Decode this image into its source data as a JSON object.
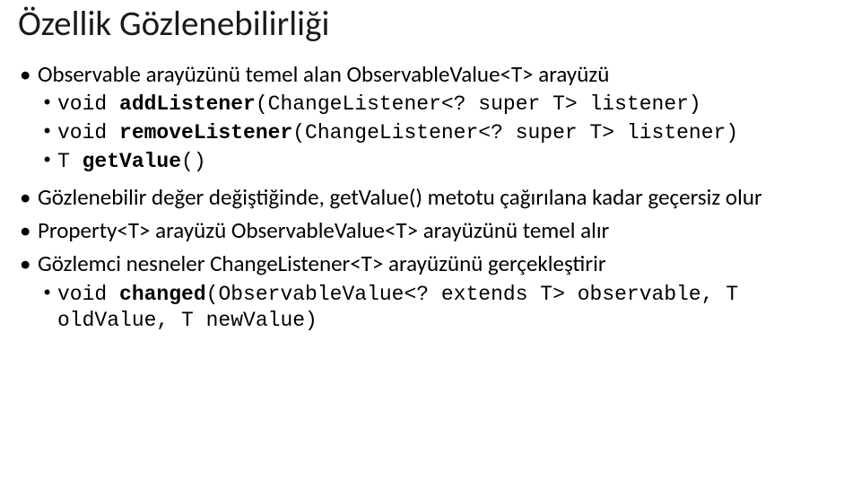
{
  "title": "Özellik Gözlenebilirliği",
  "b1": {
    "p1": "Observable arayüzünü temel alan ObservableValue<T> arayüzü",
    "sub": {
      "s1_a": "void ",
      "s1_b": "addListener",
      "s1_c": "(ChangeListener<? super T> listener)",
      "s2_a": "void ",
      "s2_b": "removeListener",
      "s2_c": "(ChangeListener<? super T> listener)",
      "s3_a": "T ",
      "s3_b": "getValue",
      "s3_c": "()"
    }
  },
  "b2": "Gözlenebilir değer değiştiğinde, getValue()  metotu çağırılana kadar geçersiz olur",
  "b3": "Property<T> arayüzü ObservableValue<T> arayüzünü temel alır",
  "b4": {
    "p1": "Gözlemci nesneler ChangeListener<T> arayüzünü gerçekleştirir",
    "sub": {
      "s1_a": "void ",
      "s1_b": "changed",
      "s1_c": "(ObservableValue<? extends T> observable, T oldValue, T newValue)"
    }
  }
}
